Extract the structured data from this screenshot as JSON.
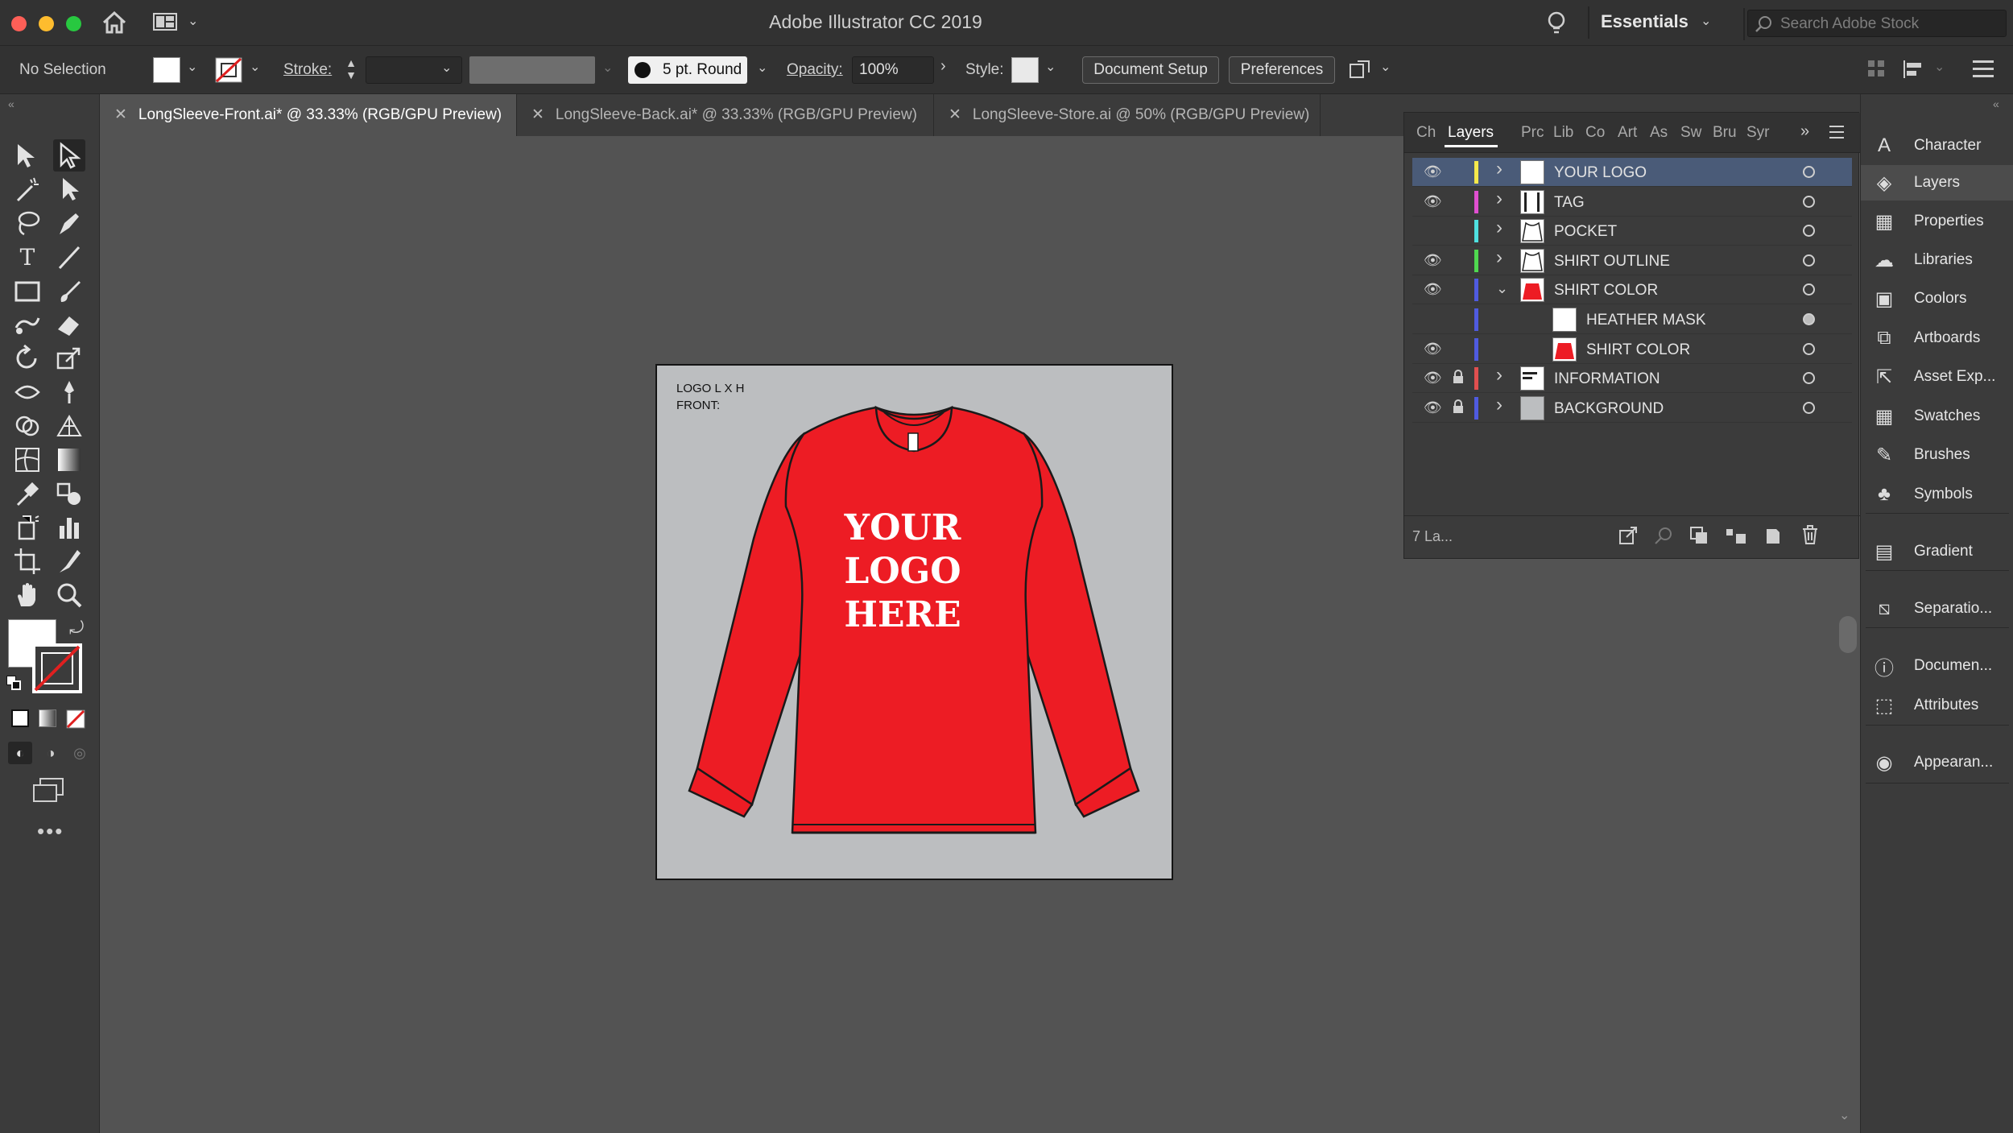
{
  "window": {
    "title": "Adobe Illustrator CC 2019",
    "workspace": "Essentials",
    "search_placeholder": "Search Adobe Stock"
  },
  "control_bar": {
    "selection_label": "No Selection",
    "stroke_label": "Stroke:",
    "brush_value": "5 pt. Round",
    "opacity_label": "Opacity:",
    "opacity_value": "100%",
    "style_label": "Style:",
    "document_setup_label": "Document Setup",
    "preferences_label": "Preferences"
  },
  "tabs": [
    {
      "label": "LongSleeve-Front.ai* @ 33.33% (RGB/GPU Preview)",
      "active": true
    },
    {
      "label": "LongSleeve-Back.ai* @ 33.33% (RGB/GPU Preview)",
      "active": false
    },
    {
      "label": "LongSleeve-Store.ai @ 50% (RGB/GPU Preview)",
      "active": false
    }
  ],
  "artboard": {
    "info_line1": "LOGO L X H",
    "info_line2": "FRONT:",
    "logo_line1": "YOUR",
    "logo_line2": "LOGO",
    "logo_line3": "HERE",
    "shirt_color": "#ed1c24",
    "background_color": "#bcbec0"
  },
  "layers_panel": {
    "tabs": [
      "Ch",
      "Layers",
      "Prc",
      "Lib",
      "Co",
      "Art",
      "As",
      "Sw",
      "Bru",
      "Syr"
    ],
    "active_tab": "Layers",
    "footer_count": "7 La...",
    "layers": [
      {
        "name": "YOUR LOGO",
        "visible": true,
        "locked": false,
        "color": "#f5e94b",
        "expanded": false,
        "indent": 0,
        "selected": true
      },
      {
        "name": "TAG",
        "visible": true,
        "locked": false,
        "color": "#e04fd0",
        "expanded": false,
        "indent": 0,
        "selected": false
      },
      {
        "name": "POCKET",
        "visible": false,
        "locked": false,
        "color": "#4fe0e0",
        "expanded": false,
        "indent": 0,
        "selected": false
      },
      {
        "name": "SHIRT OUTLINE",
        "visible": true,
        "locked": false,
        "color": "#4fd84f",
        "expanded": false,
        "indent": 0,
        "selected": false
      },
      {
        "name": "SHIRT COLOR",
        "visible": true,
        "locked": false,
        "color": "#4f5be0",
        "expanded": true,
        "indent": 0,
        "selected": false
      },
      {
        "name": "HEATHER MASK",
        "visible": false,
        "locked": false,
        "color": "#4f5be0",
        "expanded": false,
        "indent": 1,
        "selected": false
      },
      {
        "name": "SHIRT COLOR",
        "visible": true,
        "locked": false,
        "color": "#4f5be0",
        "expanded": false,
        "indent": 1,
        "selected": false
      },
      {
        "name": "INFORMATION",
        "visible": true,
        "locked": true,
        "color": "#e04f4f",
        "expanded": false,
        "indent": 0,
        "selected": false
      },
      {
        "name": "BACKGROUND",
        "visible": true,
        "locked": true,
        "color": "#4f5be0",
        "expanded": false,
        "indent": 0,
        "selected": false
      }
    ]
  },
  "right_dock": {
    "items": [
      {
        "label": "Character",
        "icon": "character-icon"
      },
      {
        "label": "Layers",
        "icon": "layers-icon"
      },
      {
        "label": "Properties",
        "icon": "properties-icon"
      },
      {
        "label": "Libraries",
        "icon": "libraries-icon"
      },
      {
        "label": "Coolors",
        "icon": "coolors-icon"
      },
      {
        "label": "Artboards",
        "icon": "artboards-icon"
      },
      {
        "label": "Asset Exp...",
        "icon": "asset-export-icon"
      },
      {
        "label": "Swatches",
        "icon": "swatches-icon"
      },
      {
        "label": "Brushes",
        "icon": "brushes-icon"
      },
      {
        "label": "Symbols",
        "icon": "symbols-icon"
      },
      {
        "label": "Gradient",
        "icon": "gradient-icon"
      },
      {
        "label": "Separatio...",
        "icon": "separations-icon"
      },
      {
        "label": "Documen...",
        "icon": "document-info-icon"
      },
      {
        "label": "Attributes",
        "icon": "attributes-icon"
      },
      {
        "label": "Appearan...",
        "icon": "appearance-icon"
      }
    ]
  }
}
